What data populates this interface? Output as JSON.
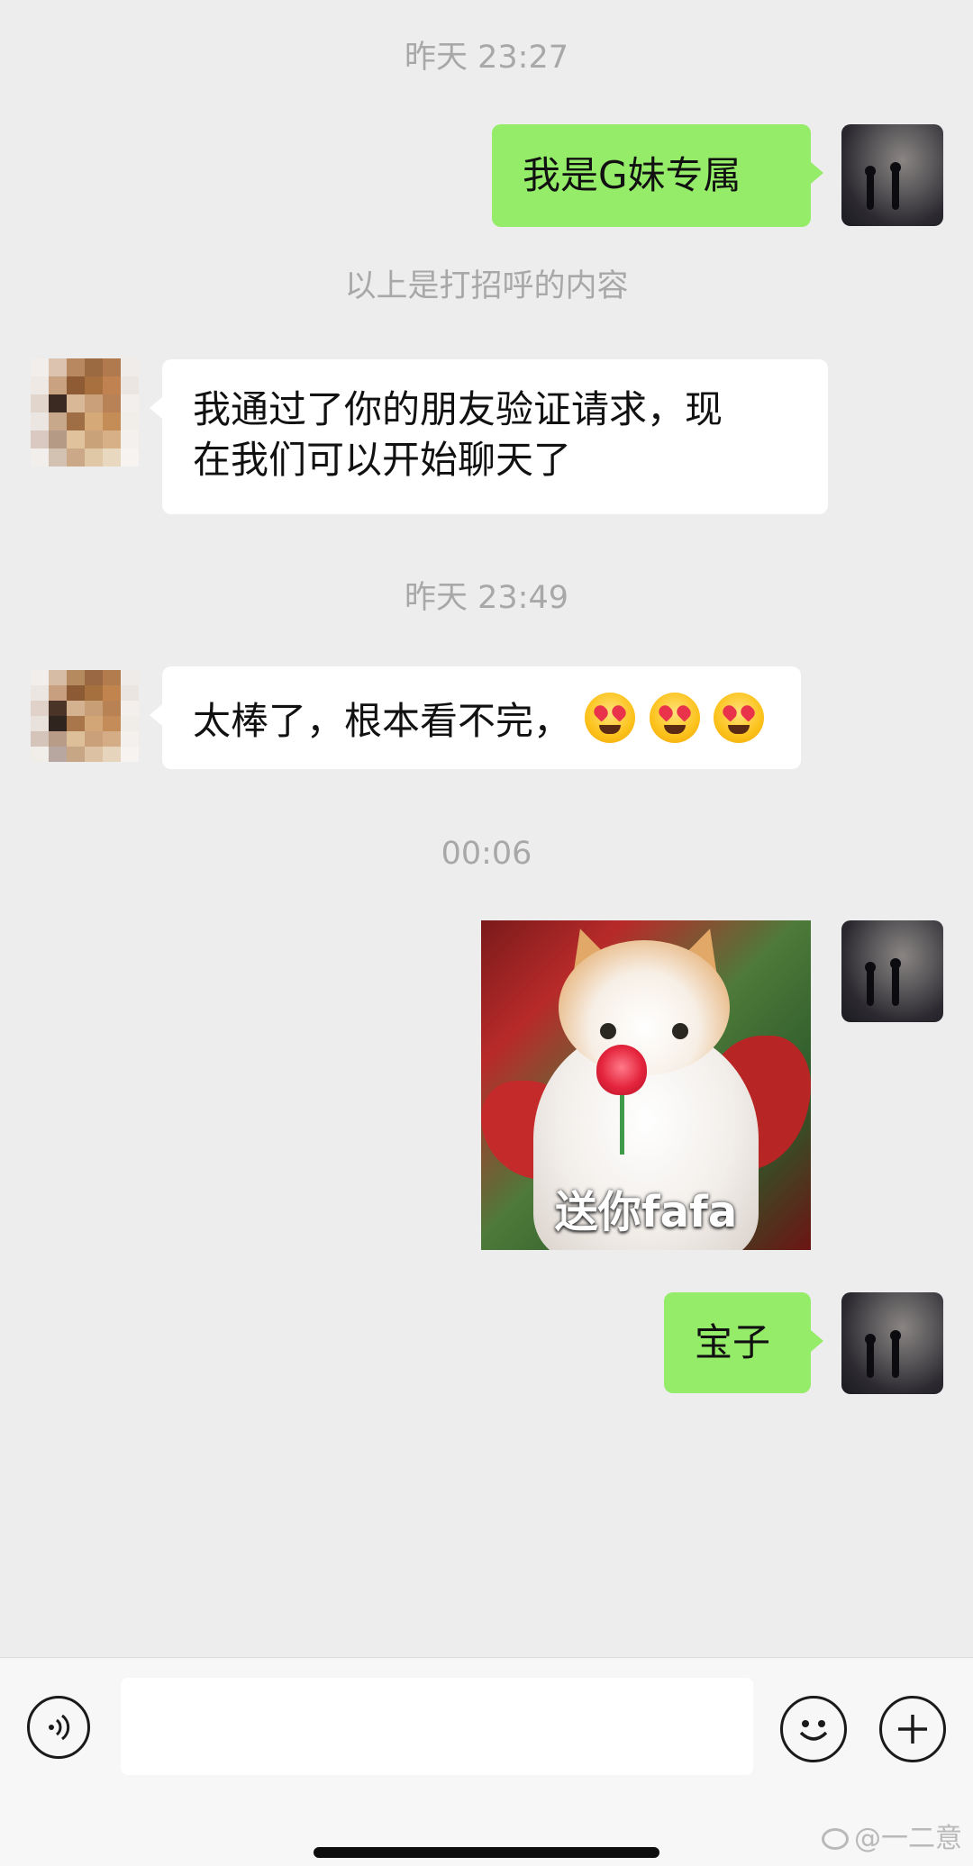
{
  "chat": {
    "timestamps": [
      "昨天 23:27",
      "昨天 23:49",
      "00:06"
    ],
    "system_notice": "以上是打招呼的内容",
    "messages": {
      "m1": "我是G妹专属",
      "m2_line1": "我通过了你的朋友验证请求，现",
      "m2_line2": "在我们可以开始聊天了",
      "m3": "太棒了，根本看不完，",
      "m3_emoji": "heart-eyes-drooling-emoji",
      "sticker_caption": "送你fafa",
      "m5": "宝子"
    }
  },
  "input_bar": {
    "message_value": "",
    "voice_icon": "voice-icon",
    "emoji_icon": "emoji-icon",
    "plus_icon": "plus-icon"
  },
  "watermark": "@一二意",
  "colors": {
    "background": "#ededed",
    "outgoing_bubble": "#95ec69",
    "incoming_bubble": "#ffffff",
    "timestamp": "#a8a8a8"
  }
}
